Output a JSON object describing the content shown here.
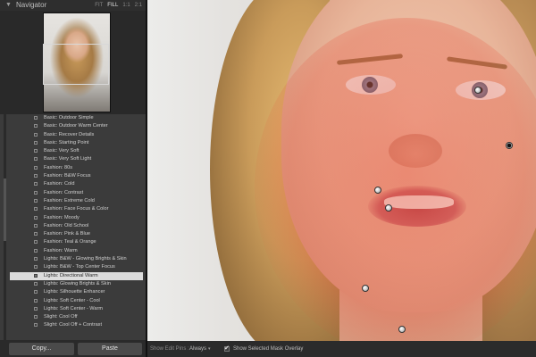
{
  "navigator": {
    "title": "Navigator",
    "zoom_options": [
      "FIT",
      "FILL",
      "1:1",
      "2:1"
    ],
    "selected_zoom": "FILL"
  },
  "presets": [
    {
      "label": "Basic: Outdoor Simple"
    },
    {
      "label": "Basic: Outdoor Warm Center"
    },
    {
      "label": "Basic: Recover Details"
    },
    {
      "label": "Basic: Starting Point"
    },
    {
      "label": "Basic: Very Soft"
    },
    {
      "label": "Basic: Very Soft Light"
    },
    {
      "label": "Fashion: 80s"
    },
    {
      "label": "Fashion: B&W Focus"
    },
    {
      "label": "Fashion: Cold"
    },
    {
      "label": "Fashion: Contrast"
    },
    {
      "label": "Fashion: Extreme Cold"
    },
    {
      "label": "Fashion: Face Focus & Color"
    },
    {
      "label": "Fashion: Moody"
    },
    {
      "label": "Fashion: Old School"
    },
    {
      "label": "Fashion: Pink & Blue"
    },
    {
      "label": "Fashion: Teal & Orange"
    },
    {
      "label": "Fashion: Warm"
    },
    {
      "label": "Lights: B&W - Glowing Brights & Skin"
    },
    {
      "label": "Lights: B&W - Top Center Focus"
    },
    {
      "label": "Lights: Directional Warm"
    },
    {
      "label": "Lights: Glowing Brights & Skin"
    },
    {
      "label": "Lights: Silhouette Enhancer"
    },
    {
      "label": "Lights: Soft Center - Cool"
    },
    {
      "label": "Lights: Soft Center - Warm"
    },
    {
      "label": "Slight: Cool Off"
    },
    {
      "label": "Slight: Cool Off + Contrast"
    }
  ],
  "selected_preset_index": 19,
  "buttons": {
    "copy": "Copy...",
    "paste": "Paste"
  },
  "toolbar": {
    "show_edit_pins_label": "Show Edit Pins :",
    "show_edit_pins_value": "Always",
    "show_mask_overlay_label": "Show Selected Mask Overlay",
    "show_mask_overlay_checked": true
  },
  "colors": {
    "panel_bg": "#3b3b3b",
    "selected_row_bg": "#dcdcdc",
    "mask_overlay": "#e64632"
  },
  "edit_pins": [
    {
      "name": "pin-eye-right",
      "active": false
    },
    {
      "name": "pin-cheek-right",
      "active": true
    },
    {
      "name": "pin-lip-left",
      "active": false
    },
    {
      "name": "pin-lip-lower",
      "active": false
    },
    {
      "name": "pin-chin",
      "active": false
    },
    {
      "name": "pin-neck",
      "active": false
    }
  ]
}
